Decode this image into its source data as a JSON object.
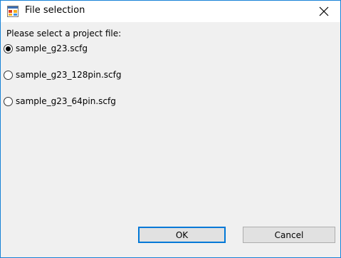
{
  "window": {
    "title": "File selection",
    "app_icon": "windows-form-icon",
    "close_glyph": "✕"
  },
  "prompt": "Please select a project file:",
  "options": [
    {
      "label": "sample_g23.scfg",
      "checked": true
    },
    {
      "label": "sample_g23_128pin.scfg",
      "checked": false
    },
    {
      "label": "sample_g23_64pin.scfg",
      "checked": false
    }
  ],
  "buttons": {
    "ok": "OK",
    "cancel": "Cancel"
  },
  "colors": {
    "border_accent": "#1883d7",
    "focus_border": "#0078d7",
    "background": "#f0f0f0"
  }
}
